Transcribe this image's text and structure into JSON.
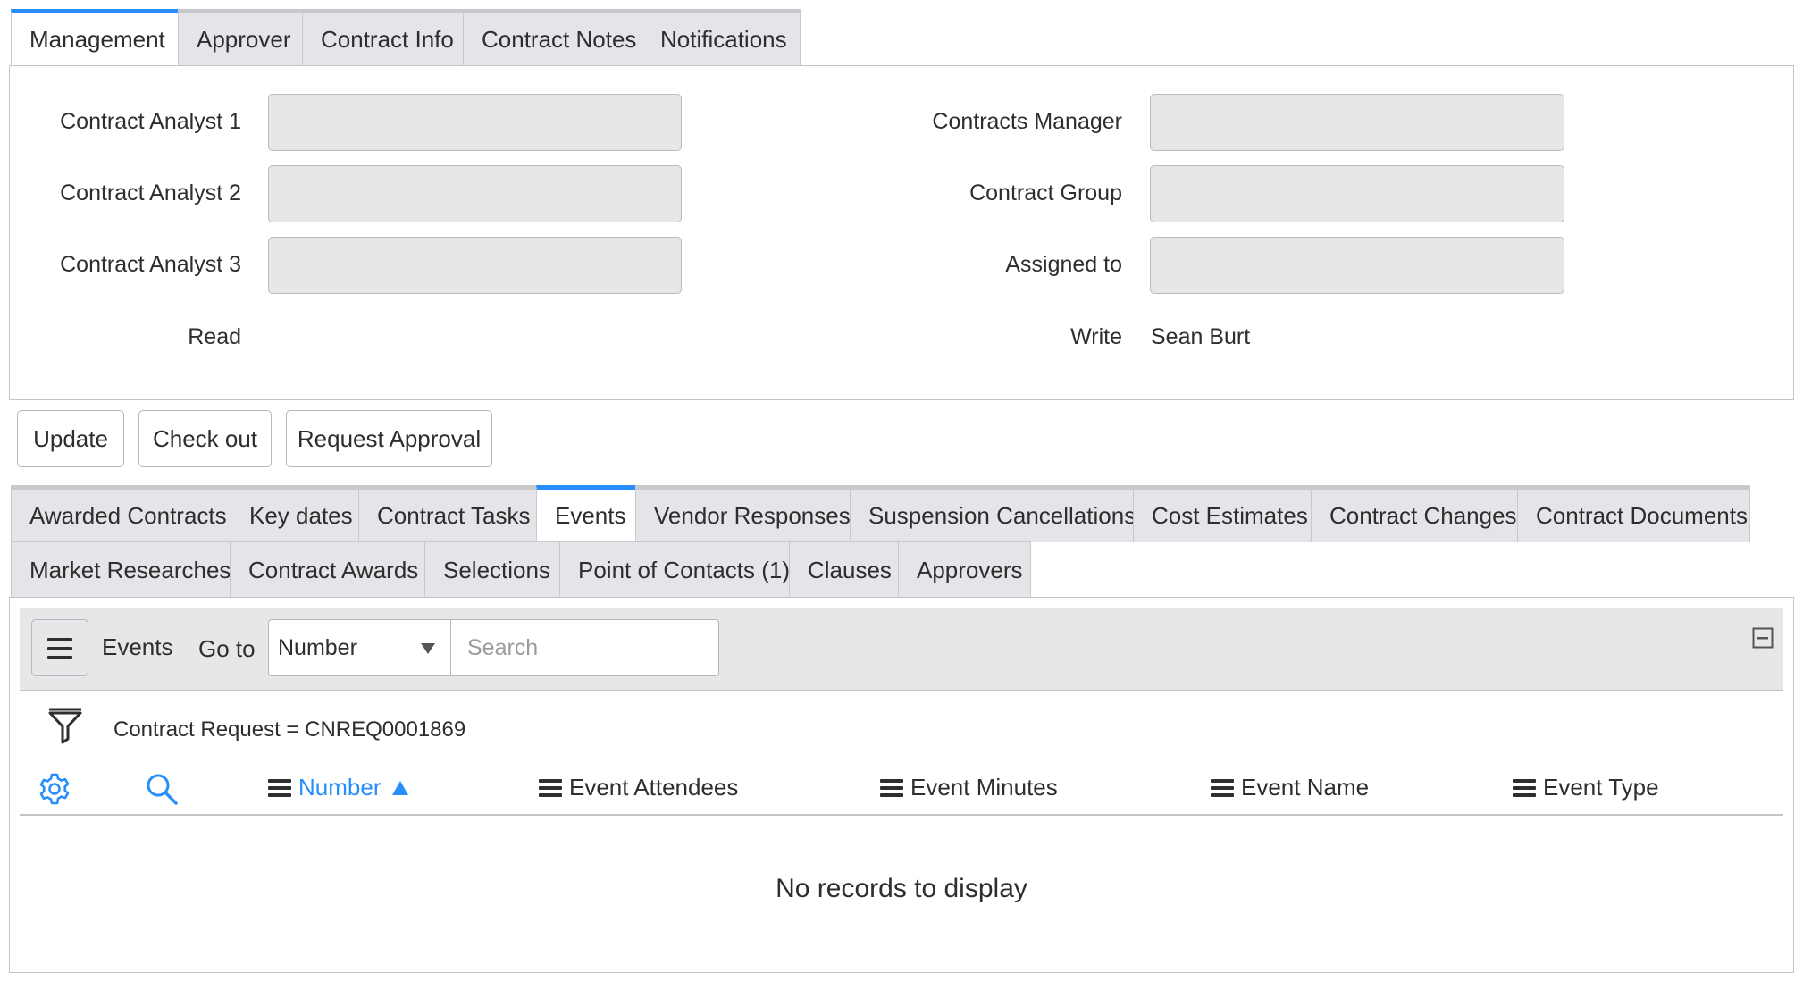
{
  "top_tabs": [
    {
      "label": "Management",
      "active": true
    },
    {
      "label": "Approver",
      "active": false
    },
    {
      "label": "Contract Info",
      "active": false
    },
    {
      "label": "Contract Notes",
      "active": false
    },
    {
      "label": "Notifications",
      "active": false
    }
  ],
  "management": {
    "contract_analyst_1": {
      "label": "Contract Analyst 1",
      "value": ""
    },
    "contract_analyst_2": {
      "label": "Contract Analyst 2",
      "value": ""
    },
    "contract_analyst_3": {
      "label": "Contract Analyst 3",
      "value": ""
    },
    "read": {
      "label": "Read",
      "value": ""
    },
    "contracts_manager": {
      "label": "Contracts Manager",
      "value": ""
    },
    "contract_group": {
      "label": "Contract Group",
      "value": ""
    },
    "assigned_to": {
      "label": "Assigned to",
      "value": ""
    },
    "write": {
      "label": "Write",
      "value": "Sean Burt"
    }
  },
  "actions": {
    "update": "Update",
    "check_out": "Check out",
    "request_approval": "Request Approval"
  },
  "related_tabs": {
    "row1": [
      "Awarded Contracts",
      "Key dates",
      "Contract Tasks",
      "Events",
      "Vendor Responses",
      "Suspension Cancellations",
      "Cost Estimates",
      "Contract Changes",
      "Contract Documents"
    ],
    "row2": [
      "Market Researches",
      "Contract Awards",
      "Selections",
      "Point of Contacts (1)",
      "Clauses",
      "Approvers"
    ],
    "active": "Events"
  },
  "list": {
    "title": "Events",
    "goto_label": "Go to",
    "search_field": "Number",
    "search_placeholder": "Search",
    "filter_text": "Contract Request = CNREQ0001869",
    "columns": [
      "Number",
      "Event Attendees",
      "Event Minutes",
      "Event Name",
      "Event Type"
    ],
    "sorted_column": "Number",
    "sort_direction": "ascending",
    "empty_text": "No records to display"
  },
  "colors": {
    "accent": "#278efc",
    "tab_bg": "#e3e5e8",
    "field_bg": "#e6e7e9"
  },
  "icons": [
    "hamburger-icon",
    "collapse-icon",
    "filter-funnel-icon",
    "gear-icon",
    "search-icon",
    "dropdown-caret-icon",
    "sort-ascending-icon"
  ]
}
